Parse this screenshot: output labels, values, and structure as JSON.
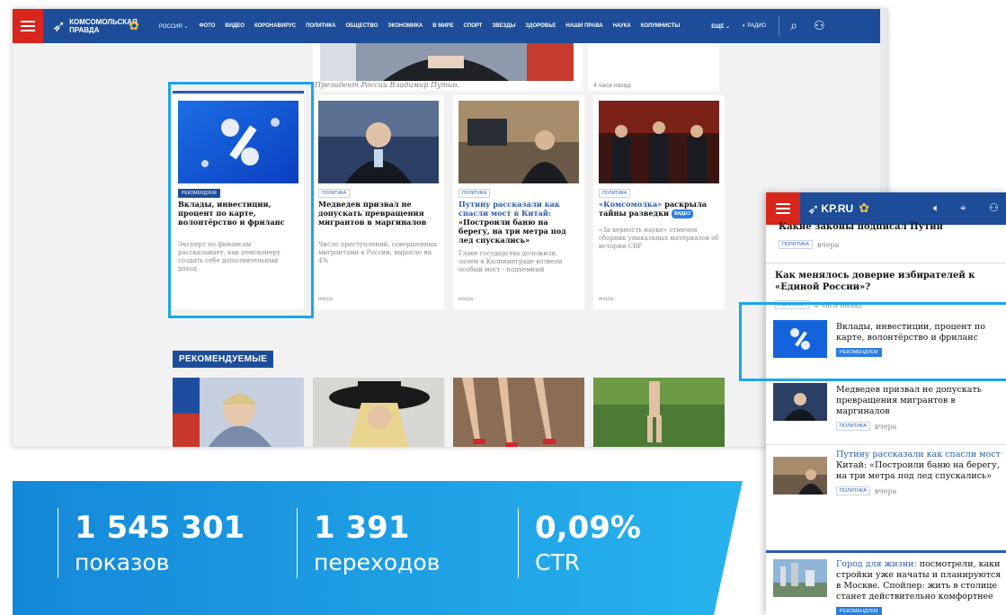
{
  "desktop": {
    "menu_label": "",
    "logo_text": "Комсомольская правда",
    "region": "РОССИЯ",
    "nav_items": [
      "ФОТО",
      "ВИДЕО",
      "КОРОНАВИРУС",
      "ПОЛИТИКА",
      "ОБЩЕСТВО",
      "ЭКОНОМИКА",
      "В МИРЕ",
      "СПОРТ",
      "ЗВЕЗДЫ",
      "ЗДОРОВЬЕ",
      "НАШИ ПРАВА",
      "НАУКА",
      "КОЛУМНИСТЫ"
    ],
    "nav_more": "ЕЩЕ",
    "radio_label": "РАДИО",
    "top_caption": "Президент России Владимир Путин.",
    "top_time": "4 часа назад",
    "cards": [
      {
        "tag": "РЕКОМЕНДУЕМ",
        "title": "Вклады, инвестиции, процент по карте, волонтёрство и фриланс",
        "lead": "Эксперт по финансам рассказывает, как пенсионеру создать себе дополнительный доход",
        "time": ""
      },
      {
        "tag": "ПОЛИТИКА",
        "title": "Медведев призвал не допускать превращения мигрантов в маргиналов",
        "lead": "Число преступлений, совершенных мигрантами в России, выросло на 4%",
        "time": "вчера"
      },
      {
        "tag": "ПОЛИТИКА",
        "title_hl": "Путину рассказали как спасли мост в Китай:",
        "title_rest": "«Построили баню на берегу, на три метра под лед спускались»",
        "lead": "Главе государства доложили, зачем в Калининграде возвели особый мост - подъемный",
        "time": "вчера"
      },
      {
        "tag": "ПОЛИТИКА",
        "title_hl": "«Комсомолка»",
        "title_rest": "раскрыла тайны разведки",
        "video_badge": "ВИДЕО",
        "lead": "«За верность науке» отмечен сборник уникальных материалов об истории СВР",
        "time": "вчера"
      }
    ],
    "section_title": "РЕКОМЕНДУЕМЫЕ"
  },
  "stats": [
    {
      "value": "1 545 301",
      "label": "показов"
    },
    {
      "value": "1 391",
      "label": "переходов"
    },
    {
      "value": "0,09%",
      "label": "CTR"
    }
  ],
  "mobile": {
    "logo_text": "KP.RU",
    "items": [
      {
        "title": "Какие законы подписал Путин",
        "tag": "ПОЛИТИКА",
        "time": "вчера"
      },
      {
        "title": "Как менялось доверие избирателей к «Единой России»?",
        "tag": "ПОЛИТИКА",
        "time": "4 часа назад"
      },
      {
        "title": "Вклады, инвестиции, процент по карте, волонтёрство и фриланс",
        "tag": "РЕКОМЕНДУЕМ"
      },
      {
        "title": "Медведев призвал не допускать превращения мигрантов в маргиналов",
        "tag": "ПОЛИТИКА",
        "time": "вчера"
      },
      {
        "title_hl": "Путину рассказали как спасли мост",
        "title_rest": "Китай: «Построили баню на берегу, на три метра под лед спускались»",
        "tag": "ПОЛИТИКА",
        "time": "вчера"
      },
      {
        "title_hl": "Город для жизни:",
        "title_rest": "посмотрели, каки стройки уже начаты и планируются в Москве. Спойлер: жить в столице станет действительно комфортнее",
        "tag": "РЕКОМЕНДУЕМ"
      }
    ]
  },
  "colors": {
    "nav_blue": "#1d4d98",
    "menu_red": "#d9261c",
    "highlight": "#1aa6ea",
    "banner_start": "#1488d8",
    "banner_end": "#27b3ee"
  }
}
